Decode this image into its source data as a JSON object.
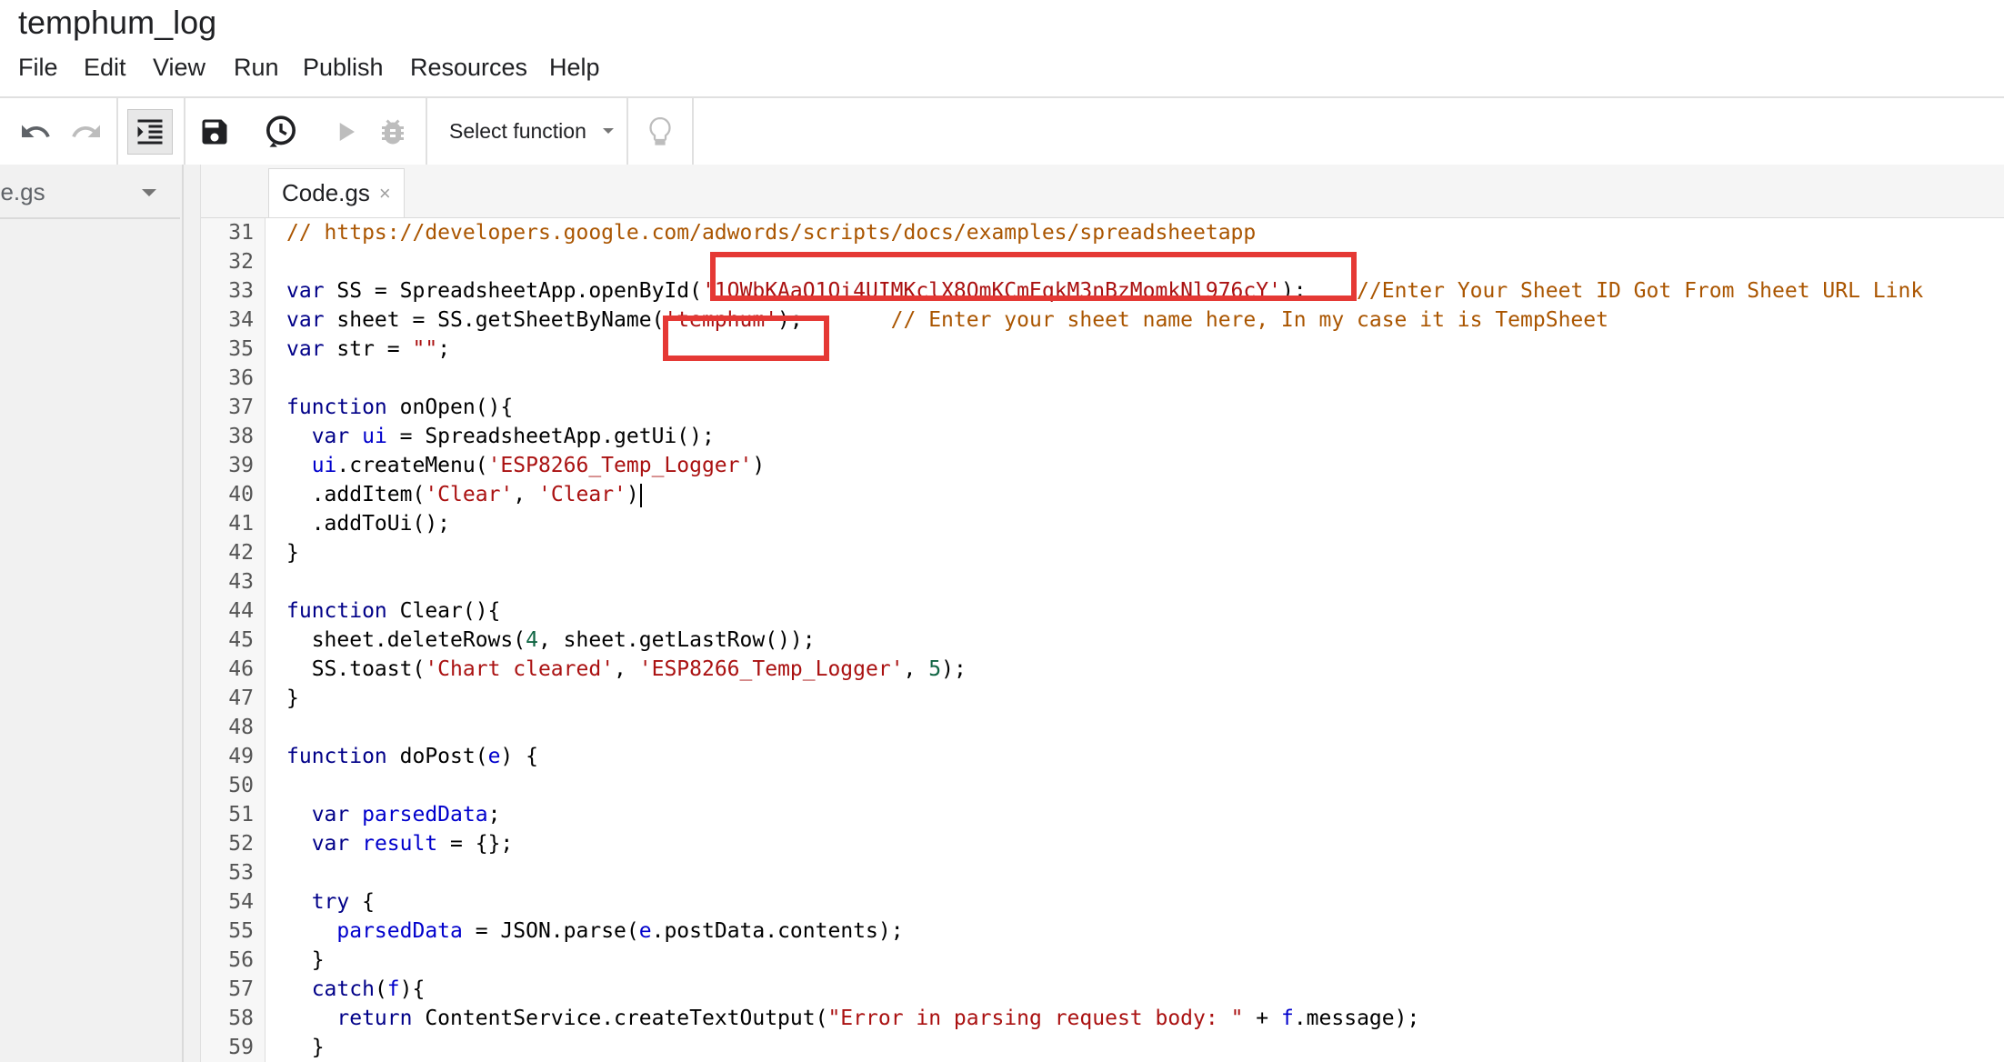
{
  "app": {
    "title": "temphum_log"
  },
  "menu": {
    "items": [
      {
        "label": "File"
      },
      {
        "label": "Edit"
      },
      {
        "label": "View"
      },
      {
        "label": "Run"
      },
      {
        "label": "Publish"
      },
      {
        "label": "Resources"
      },
      {
        "label": "Help"
      }
    ]
  },
  "toolbar": {
    "select_function_label": "Select function",
    "icons": [
      "undo-icon",
      "redo-icon",
      "indent-icon",
      "save-icon",
      "triggers-clock-icon",
      "run-play-icon",
      "debug-bug-icon",
      "lightbulb-icon"
    ]
  },
  "file_panel": {
    "current_file": "de.gs"
  },
  "editor": {
    "tab_label": "Code.gs",
    "tab_close": "×",
    "lines": [
      {
        "num": "31",
        "t0": "// https://developers.google.com/adwords/scripts/docs/examples/spreadsheetapp"
      },
      {
        "num": "32"
      },
      {
        "num": "33",
        "t0": "var",
        "t1": " SS = SpreadsheetApp.openById(",
        "t2": "'1QWbKAaO1Qi4UIMKclX8QmKCmEqkM3nBzMomkNl976cY'",
        "t3": ");    ",
        "t4": "//Enter Your Sheet ID Got From Sheet URL Link"
      },
      {
        "num": "34",
        "t0": "var",
        "t1": " sheet = SS.getSheetByName(",
        "t2": "'temphum'",
        "t3": ");       ",
        "t4": "// Enter your sheet name here, In my case it is TempSheet"
      },
      {
        "num": "35",
        "t0": "var",
        "t1": " str = ",
        "t2": "\"\"",
        "t3": ";"
      },
      {
        "num": "36"
      },
      {
        "num": "37",
        "t0": "function",
        "t1": " onOpen(){"
      },
      {
        "num": "38",
        "t0": "  var",
        "t1": " ui",
        "t2": " = SpreadsheetApp.getUi();"
      },
      {
        "num": "39",
        "t0": "  ui",
        "t1": ".createMenu(",
        "t2": "'ESP8266_Temp_Logger'",
        "t3": ")"
      },
      {
        "num": "40",
        "t0": "  .addItem(",
        "t1": "'Clear'",
        "t2": ", ",
        "t3": "'Clear'",
        "t4": ")"
      },
      {
        "num": "41",
        "t0": "  .addToUi();"
      },
      {
        "num": "42",
        "t0": "}"
      },
      {
        "num": "43"
      },
      {
        "num": "44",
        "t0": "function",
        "t1": " Clear(){"
      },
      {
        "num": "45",
        "t0": "  sheet.deleteRows(",
        "t1": "4",
        "t2": ", sheet.getLastRow());"
      },
      {
        "num": "46",
        "t0": "  SS.toast(",
        "t1": "'Chart cleared'",
        "t2": ", ",
        "t3": "'ESP8266_Temp_Logger'",
        "t4": ", ",
        "t5": "5",
        "t6": ");"
      },
      {
        "num": "47",
        "t0": "}"
      },
      {
        "num": "48"
      },
      {
        "num": "49",
        "t0": "function",
        "t1": " doPost(",
        "t2": "e",
        "t3": ") {"
      },
      {
        "num": "50"
      },
      {
        "num": "51",
        "t0": "  var",
        "t1": " parsedData",
        "t2": ";"
      },
      {
        "num": "52",
        "t0": "  var",
        "t1": " result",
        "t2": " = {};"
      },
      {
        "num": "53"
      },
      {
        "num": "54",
        "t0": "  try",
        "t1": " {"
      },
      {
        "num": "55",
        "t0": "    parsedData",
        "t1": " = JSON.parse(",
        "t2": "e",
        "t3": ".postData.contents);"
      },
      {
        "num": "56",
        "t0": "  }"
      },
      {
        "num": "57",
        "t0": "  catch",
        "t1": "(",
        "t2": "f",
        "t3": "){"
      },
      {
        "num": "58",
        "t0": "    return",
        "t1": " ContentService.createTextOutput(",
        "t2": "\"Error in parsing request body: \"",
        "t3": " + ",
        "t4": "f",
        "t5": ".message);"
      },
      {
        "num": "59",
        "t0": "  }"
      }
    ]
  },
  "colors": {
    "highlight_box": "#e53935",
    "keyword": "#000088",
    "string": "#aa1111",
    "comment": "#aa5500",
    "number": "#116644",
    "variable": "#0000cc"
  }
}
